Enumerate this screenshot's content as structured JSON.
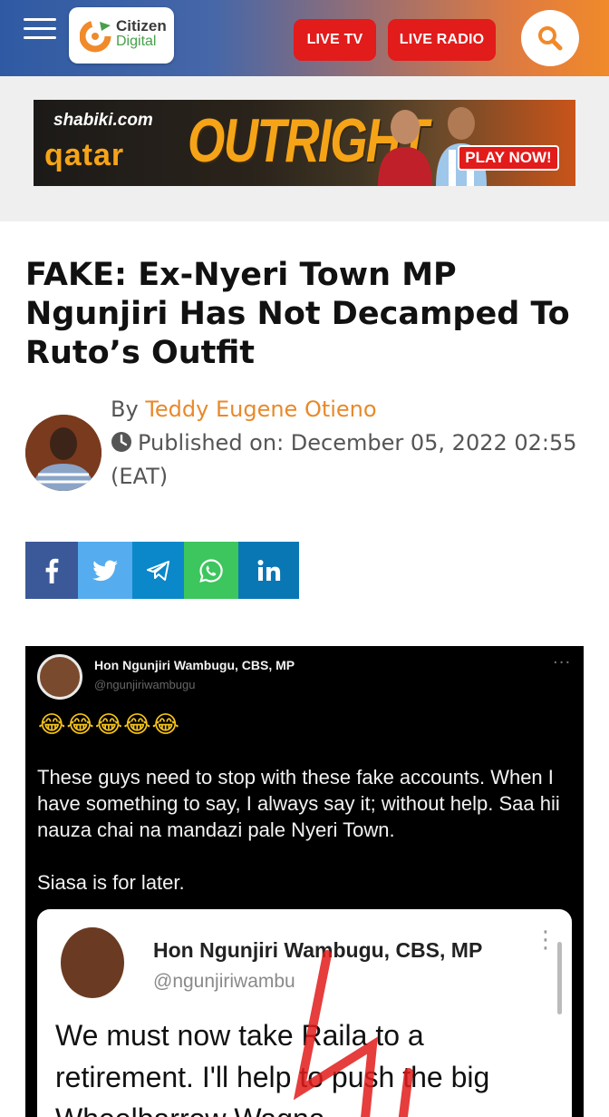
{
  "header": {
    "logo": {
      "line1": "Citizen",
      "line2": "Digital"
    },
    "live_tv_label": "LIVE TV",
    "live_radio_label": "LIVE RADIO",
    "icons": {
      "menu": "hamburger-icon",
      "search": "search-icon"
    },
    "colors": {
      "gradient_start": "#2f5aa3",
      "gradient_end": "#f08a2a",
      "pill": "#e21b1b"
    }
  },
  "ad": {
    "brand": "shabiki.com",
    "tagline_left": "qatar",
    "headline": "OUTRIGHT",
    "cta": "PLAY NOW!"
  },
  "article": {
    "title": "FAKE: Ex-Nyeri Town MP Ngunjiri Has Not Decamped To Ruto’s Outfit",
    "by_prefix": "By",
    "author": "Teddy Eugene Otieno",
    "published_label": "Published on:",
    "published_date": "December 05, 2022 02:55 (EAT)",
    "author_color": "#e8892a"
  },
  "share": {
    "buttons": [
      {
        "network": "facebook",
        "icon": "facebook-icon",
        "color": "#3b5998"
      },
      {
        "network": "twitter",
        "icon": "twitter-icon",
        "color": "#55acee"
      },
      {
        "network": "telegram",
        "icon": "telegram-icon",
        "color": "#0a88c9"
      },
      {
        "network": "whatsapp",
        "icon": "whatsapp-icon",
        "color": "#3dc55e"
      },
      {
        "network": "linkedin",
        "icon": "linkedin-icon",
        "color": "#0a77b5"
      }
    ]
  },
  "embed": {
    "tweet_name": "Hon Ngunjiri Wambugu, CBS, MP",
    "tweet_handle": "@ngunjiriwambugu",
    "more": "···",
    "emoji": "😂😂😂😂😂",
    "body": "These guys need to stop with these fake accounts. When I have something to say, I always say it; without help. Saa hii nauza chai na mandazi pale Nyeri Town.",
    "body2": "Siasa is for later.",
    "quoted": {
      "name": "Hon Ngunjiri Wambugu, CBS, MP",
      "handle": "@ngunjiriwambu",
      "text": "We must now take Raila to a retirement. I'll help to push the big Wheelbarrow Wagna"
    }
  }
}
